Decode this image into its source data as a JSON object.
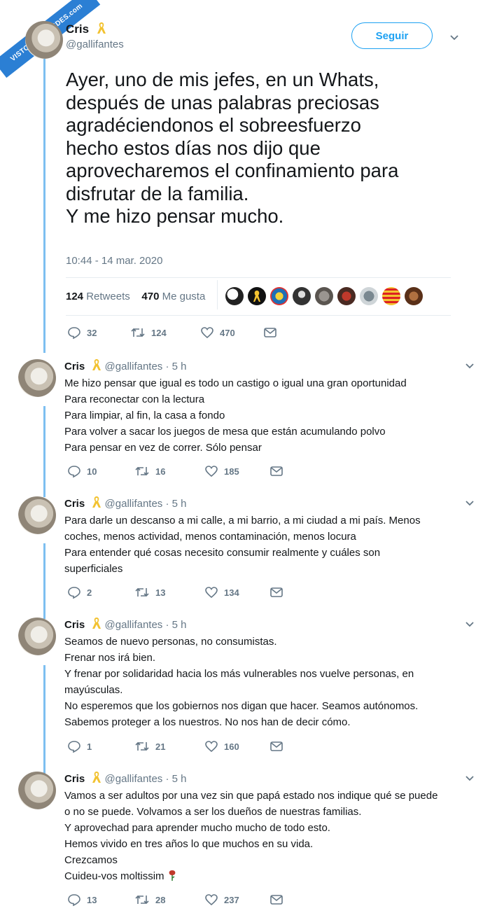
{
  "watermark": "VISTOENLASREDES.com",
  "main": {
    "author_name": "Cris",
    "author_handle": "@gallifantes",
    "follow_label": "Seguir",
    "text_lines": [
      "Ayer, uno de mis jefes, en un Whats,",
      "después de unas palabras preciosas",
      "agradéciendonos el sobreesfuerzo",
      "hecho estos días nos dijo que",
      "aprovecharemos el confinamiento para",
      "disfrutar de la familia.",
      "Y me hizo pensar mucho."
    ],
    "timestamp": "10:44 - 14 mar. 2020",
    "retweets_count": "124",
    "retweets_label": "Retweets",
    "likes_count": "470",
    "likes_label": "Me gusta",
    "actions": {
      "replies": "32",
      "retweets": "124",
      "likes": "470"
    }
  },
  "replies": [
    {
      "name": "Cris",
      "handle": "@gallifantes",
      "time": "· 5 h",
      "lines": [
        "Me hizo pensar que igual es todo un castigo o igual una gran oportunidad",
        "Para reconectar con la lectura",
        "Para limpiar, al fin, la casa a fondo",
        "Para volver a sacar los juegos de mesa que están acumulando polvo",
        "Para pensar en vez de correr. Sólo pensar"
      ],
      "replies": "10",
      "retweets": "16",
      "likes": "185"
    },
    {
      "name": "Cris",
      "handle": "@gallifantes",
      "time": "· 5 h",
      "lines": [
        "Para darle un descanso a mi calle, a mi barrio, a mi ciudad a mi país. Menos",
        "coches, menos actividad, menos contaminación, menos locura",
        "Para entender qué cosas necesito consumir realmente y cuáles son",
        "superficiales"
      ],
      "replies": "2",
      "retweets": "13",
      "likes": "134"
    },
    {
      "name": "Cris",
      "handle": "@gallifantes",
      "time": "· 5 h",
      "lines": [
        "Seamos de nuevo personas, no consumistas.",
        "Frenar nos irá bien.",
        "Y frenar por solidaridad hacia los más vulnerables nos vuelve personas, en",
        "mayúsculas.",
        "No esperemos que los gobiernos nos digan que hacer. Seamos autónomos.",
        "Sabemos proteger a los nuestros. No nos han de decir cómo."
      ],
      "replies": "1",
      "retweets": "21",
      "likes": "160"
    },
    {
      "name": "Cris",
      "handle": "@gallifantes",
      "time": "· 5 h",
      "lines": [
        "Vamos a ser adultos por una vez sin que papá estado nos indique qué se puede",
        "o no se puede. Volvamos a ser los dueños de nuestras familias.",
        "Y aprovechad para aprender mucho mucho de todo esto.",
        "Hemos vivido en tres años lo que muchos en su vida.",
        "Crezcamos",
        "Cuideu-vos moltissim"
      ],
      "replies": "13",
      "retweets": "28",
      "likes": "237"
    }
  ],
  "colors": {
    "accent": "#1da1f2",
    "thread_line": "#7dbff0",
    "muted": "#657786",
    "ribbon": "#f2c230"
  },
  "icons": [
    "yellow-ribbon-icon",
    "chevron-down-icon",
    "reply-icon",
    "retweet-icon",
    "heart-icon",
    "dm-envelope-icon",
    "rose-icon"
  ]
}
